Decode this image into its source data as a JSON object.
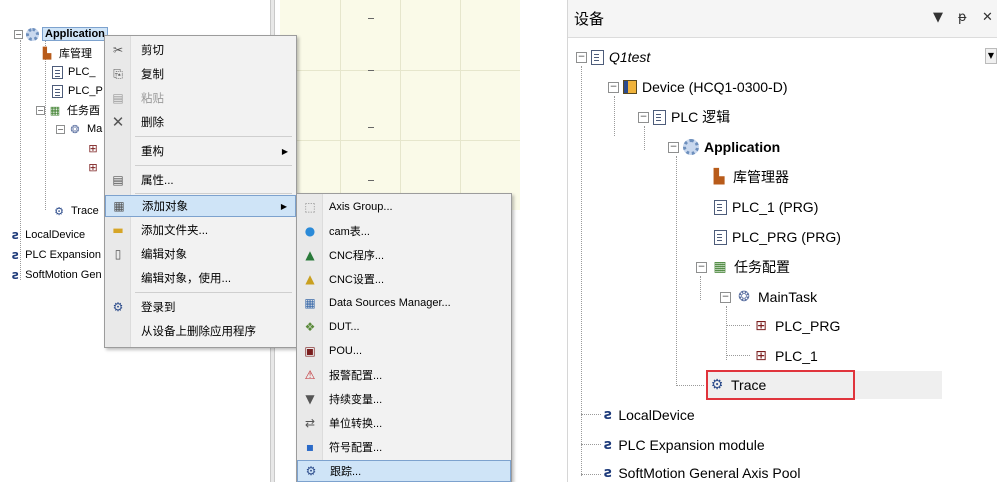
{
  "left": {
    "tree": {
      "application": "Application",
      "library_manager": "库管理",
      "plc_1": "PLC_",
      "plc_prg": "PLC_P",
      "task_config": "任务酉",
      "maintask": "Ma",
      "trace": "Trace",
      "local_device": "LocalDevice",
      "plc_expansion": "PLC Expansion",
      "softmotion": "SoftMotion Gen"
    },
    "context_menu": {
      "items": [
        {
          "icon": "✂",
          "label": "剪切"
        },
        {
          "icon": "⎘",
          "label": "复制"
        },
        {
          "icon": "▤",
          "label": "粘贴"
        },
        {
          "icon": "✕",
          "label": "删除"
        },
        {
          "icon": "",
          "label": "重构"
        },
        {
          "icon": "▤",
          "label": "属性..."
        },
        {
          "icon": "▦",
          "label": "添加对象"
        },
        {
          "icon": "▬",
          "label": "添加文件夹..."
        },
        {
          "icon": "▯",
          "label": "编辑对象"
        },
        {
          "icon": "",
          "label": "编辑对象，使用..."
        },
        {
          "icon": "⚙",
          "label": "登录到"
        },
        {
          "icon": "",
          "label": "从设备上删除应用程序"
        }
      ]
    },
    "submenu": {
      "items": [
        {
          "icon": "⬚",
          "label": "Axis Group..."
        },
        {
          "icon": "●",
          "label": "cam表..."
        },
        {
          "icon": "▲",
          "label": "CNC程序..."
        },
        {
          "icon": "▲",
          "label": "CNC设置..."
        },
        {
          "icon": "▦",
          "label": "Data Sources Manager..."
        },
        {
          "icon": "❖",
          "label": "DUT..."
        },
        {
          "icon": "▣",
          "label": "POU..."
        },
        {
          "icon": "⚠",
          "label": "报警配置..."
        },
        {
          "icon": "▼",
          "label": "持续变量..."
        },
        {
          "icon": "⇄",
          "label": "单位转换..."
        },
        {
          "icon": "▪",
          "label": "符号配置..."
        },
        {
          "icon": "⚙",
          "label": "跟踪..."
        }
      ]
    }
  },
  "right": {
    "panel_title": "设备",
    "header_buttons": {
      "dropdown": "▼",
      "pin": "ᵽ",
      "close": "✕"
    },
    "tree": {
      "project": "Q1test",
      "device": "Device (HCQ1-0300-D)",
      "plc_logic": "PLC 逻辑",
      "application": "Application",
      "library_manager": "库管理器",
      "plc_1": "PLC_1 (PRG)",
      "plc_prg": "PLC_PRG (PRG)",
      "task_config": "任务配置",
      "maintask": "MainTask",
      "plc_prg_task": "PLC_PRG",
      "plc_1_task": "PLC_1",
      "trace": "Trace",
      "local_device": "LocalDevice",
      "plc_expansion": "PLC Expansion module",
      "softmotion": "SoftMotion General Axis Pool"
    }
  },
  "colors": {
    "highlight_border": "#e0343c",
    "selection_bg": "#cfe4f7",
    "selection_border": "#7da2ce"
  }
}
